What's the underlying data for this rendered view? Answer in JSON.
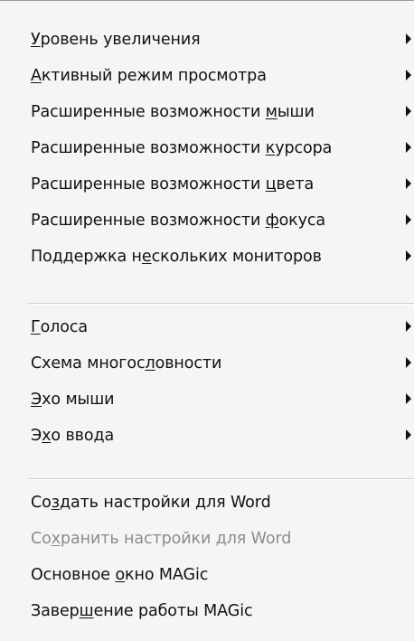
{
  "menu": {
    "groups": [
      {
        "items": [
          {
            "label": "Уровень увеличения",
            "accel_index": 0,
            "submenu": true,
            "enabled": true
          },
          {
            "label": "Активный режим просмотра",
            "accel_index": 0,
            "submenu": true,
            "enabled": true
          },
          {
            "label": "Расширенные возможности мыши",
            "accel_index": 24,
            "submenu": true,
            "enabled": true
          },
          {
            "label": "Расширенные возможности курсора",
            "accel_index": 24,
            "submenu": true,
            "enabled": true
          },
          {
            "label": "Расширенные возможности цвета",
            "accel_index": 24,
            "submenu": true,
            "enabled": true
          },
          {
            "label": "Расширенные возможности фокуса",
            "accel_index": 24,
            "submenu": true,
            "enabled": true
          },
          {
            "label": "Поддержка нескольких мониторов",
            "accel_index": 11,
            "submenu": true,
            "enabled": true
          }
        ]
      },
      {
        "items": [
          {
            "label": "Голоса",
            "accel_index": 0,
            "submenu": true,
            "enabled": true
          },
          {
            "label": "Схема многословности",
            "accel_index": 12,
            "submenu": true,
            "enabled": true
          },
          {
            "label": "Эхо мыши",
            "accel_index": 0,
            "submenu": true,
            "enabled": true
          },
          {
            "label": "Эхо ввода",
            "accel_index": 1,
            "submenu": true,
            "enabled": true
          }
        ]
      },
      {
        "items": [
          {
            "label": "Создать настройки для Word",
            "accel_index": 2,
            "submenu": false,
            "enabled": true
          },
          {
            "label": "Сохранить настройки для Word",
            "accel_index": 2,
            "submenu": false,
            "enabled": false
          },
          {
            "label": "Основное окно MAGic",
            "accel_index": 9,
            "submenu": false,
            "enabled": true
          },
          {
            "label": "Завершение работы MAGic",
            "accel_index": 5,
            "submenu": false,
            "enabled": true
          }
        ]
      }
    ]
  }
}
